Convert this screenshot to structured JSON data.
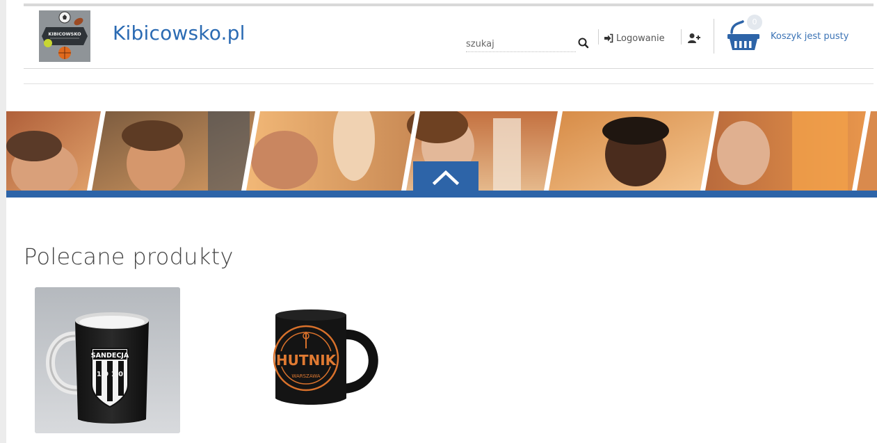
{
  "brand": {
    "site_name": "Kibicowsko.pl",
    "logo_alt": "Kibicowsko logo",
    "logo_text": "KIBICOWSKO"
  },
  "header": {
    "search": {
      "placeholder": "szukaj",
      "value": ""
    },
    "login_label": "Logowanie",
    "cart": {
      "count": "0",
      "label": "Koszyk jest pusty"
    },
    "icons": [
      "search-icon",
      "sign-in-icon",
      "user-plus-icon",
      "shopping-basket-icon"
    ]
  },
  "banner": {
    "toggle_icon": "chevron-up-icon",
    "accent_color": "#2d64a8"
  },
  "featured": {
    "title": "Polecane produkty",
    "products": [
      {
        "name": "Kubek Sandecja",
        "mug_text_1": "SANDECJA",
        "mug_text_2": "1 9 1 0"
      },
      {
        "name": "Kubek Hutnik Warszawa",
        "mug_text_1": "HUTNIK",
        "mug_text_2": "WARSZAWA"
      }
    ]
  },
  "colors": {
    "brand_blue": "#2b6bb3",
    "accent": "#2d64a8"
  }
}
